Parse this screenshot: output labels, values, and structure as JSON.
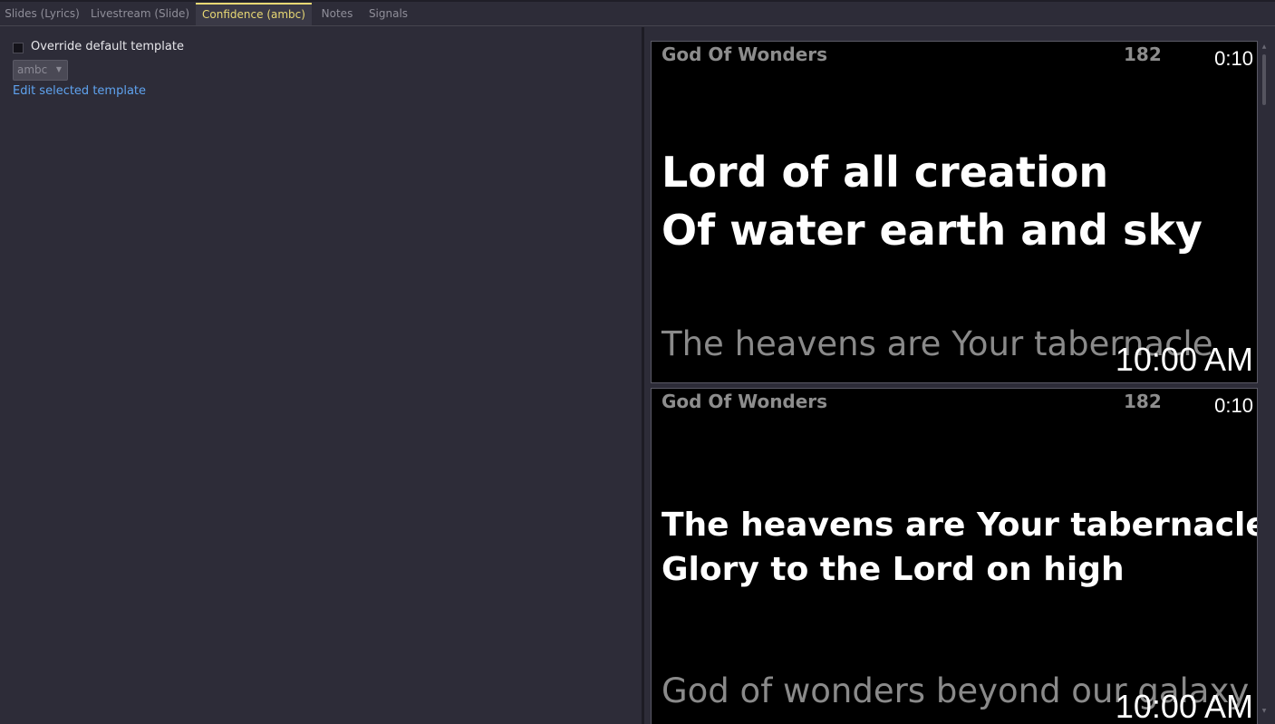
{
  "tabs": [
    {
      "label": "Slides (Lyrics)",
      "active": false
    },
    {
      "label": "Livestream (Slide)",
      "active": false
    },
    {
      "label": "Confidence (ambc)",
      "active": true
    },
    {
      "label": "Notes",
      "active": false
    },
    {
      "label": "Signals",
      "active": false
    }
  ],
  "options": {
    "override_label": "Override default template",
    "override_checked": false,
    "template_value": "ambc",
    "edit_link": "Edit selected template"
  },
  "slides": [
    {
      "title": "God Of Wonders",
      "number": "182",
      "timer": "0:10",
      "lines": [
        "Lord of all creation",
        "Of water earth and sky"
      ],
      "next": "The heavens are Your tabernacle",
      "clock": "10:00 AM"
    },
    {
      "title": "God Of Wonders",
      "number": "182",
      "timer": "0:10",
      "lines": [
        "The heavens are Your tabernacle",
        "Glory to the Lord on high"
      ],
      "next": "God of wonders beyond our galaxy",
      "clock": "10:00 AM"
    }
  ],
  "colors": {
    "active_tab": "#e8d874",
    "link": "#5fa3ef",
    "background": "#2d2c38"
  }
}
